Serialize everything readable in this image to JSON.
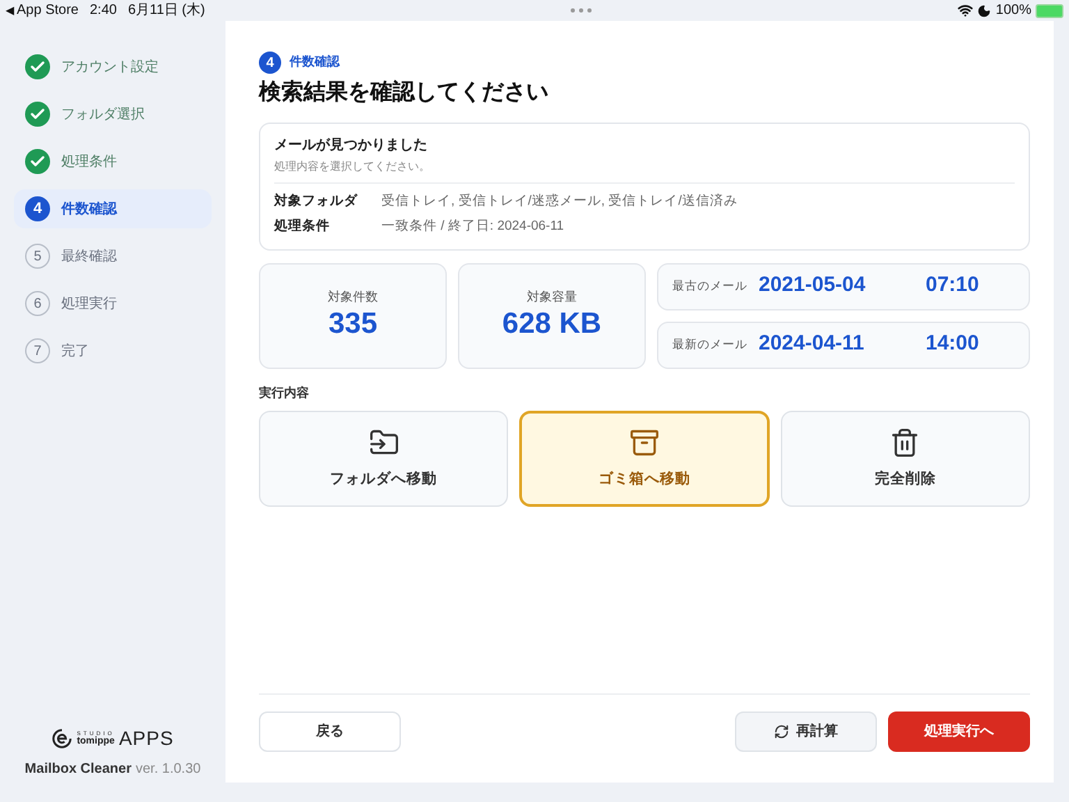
{
  "status_bar": {
    "back_arrow": "◀",
    "back_label": "App Store",
    "time": "2:40",
    "date": "6月11日 (木)",
    "battery": "100%"
  },
  "sidebar": {
    "steps": [
      {
        "kind": "done",
        "label": "アカウント設定",
        "selected": false
      },
      {
        "kind": "done",
        "label": "フォルダ選択",
        "selected": false
      },
      {
        "kind": "done",
        "label": "処理条件",
        "selected": false
      },
      {
        "kind": "number",
        "number": "4",
        "label": "件数確認",
        "selected": true
      },
      {
        "kind": "number",
        "number": "5",
        "label": "最終確認",
        "selected": false
      },
      {
        "kind": "number",
        "number": "6",
        "label": "処理実行",
        "selected": false
      },
      {
        "kind": "number",
        "number": "7",
        "label": "完了",
        "selected": false
      }
    ],
    "logo": {
      "studio": "STUDIO",
      "brand": "tomippe",
      "apps": "APPS"
    },
    "app_name": "Mailbox Cleaner",
    "version": "ver. 1.0.30"
  },
  "main": {
    "step_number": "4",
    "step_label": "件数確認",
    "title": "検索結果を確認してください",
    "info": {
      "heading": "メールが見つかりました",
      "subtext": "処理内容を選択してください。",
      "rows": [
        {
          "label": "対象フォルダ",
          "value": "受信トレイ, 受信トレイ/迷惑メール, 受信トレイ/送信済み"
        },
        {
          "label": "処理条件",
          "value": "一致条件 / 終了日: 2024-06-11"
        }
      ]
    },
    "stats": [
      {
        "label": "対象件数",
        "value": "335"
      },
      {
        "label": "対象容量",
        "value": "628 KB"
      }
    ],
    "dates": [
      {
        "label": "最古のメール",
        "date": "2021-05-04",
        "time": "07:10"
      },
      {
        "label": "最新のメール",
        "date": "2024-04-11",
        "time": "14:00"
      }
    ],
    "actions_label": "実行内容",
    "actions": [
      {
        "kind": "move",
        "label": "フォルダへ移動",
        "selected": false
      },
      {
        "kind": "trash",
        "label": "ゴミ箱へ移動",
        "selected": true
      },
      {
        "kind": "delete",
        "label": "完全削除",
        "selected": false
      }
    ],
    "buttons": {
      "back": "戻る",
      "recalc": "再計算",
      "next": "処理実行へ"
    }
  }
}
